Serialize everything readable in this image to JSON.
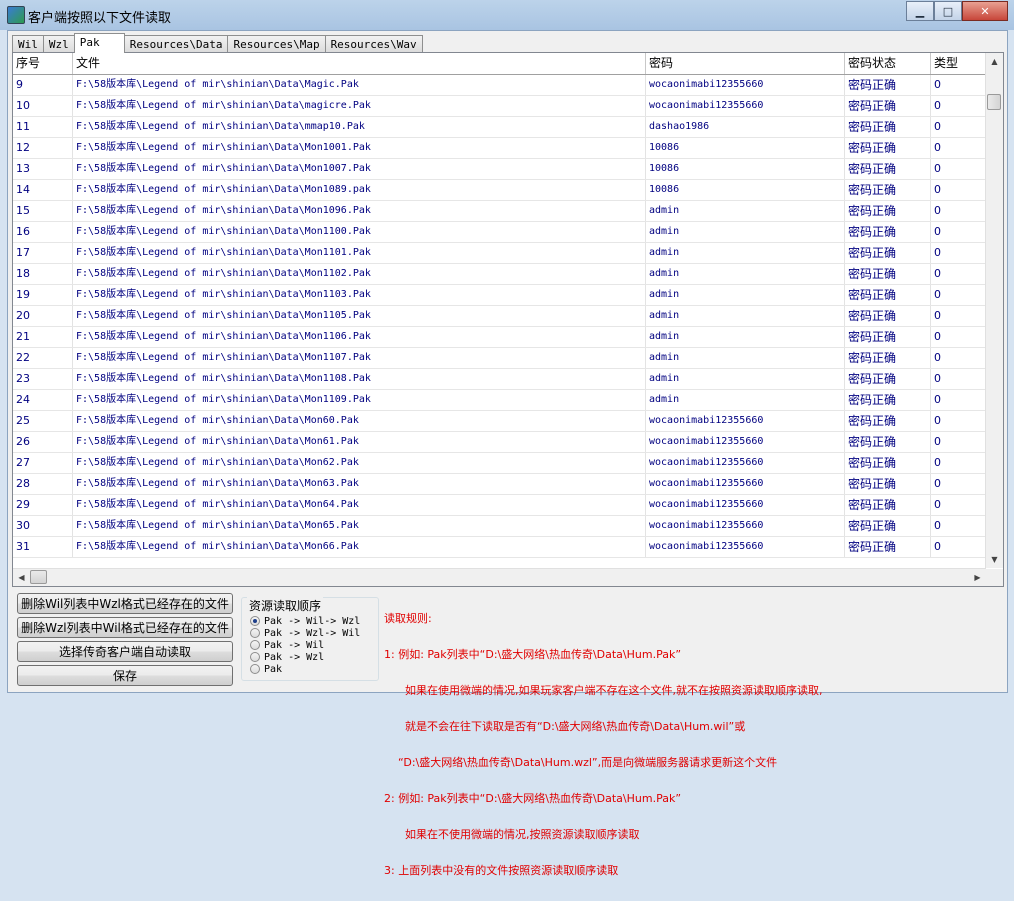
{
  "window": {
    "title": "客户端按照以下文件读取",
    "min_label": "▁",
    "max_label": "□",
    "close_label": "✕"
  },
  "tabs": [
    "Wil",
    "Wzl",
    "Pak",
    "Resources\\Data",
    "Resources\\Map",
    "Resources\\Wav"
  ],
  "active_tab": "Pak",
  "table": {
    "columns": [
      "序号",
      "文件",
      "密码",
      "密码状态",
      "类型"
    ],
    "rows": [
      [
        "9",
        "F:\\58版本库\\Legend of mir\\shinian\\Data\\Magic.Pak",
        "wocaonimabi12355660",
        "密码正确",
        "0"
      ],
      [
        "10",
        "F:\\58版本库\\Legend of mir\\shinian\\Data\\magicre.Pak",
        "wocaonimabi12355660",
        "密码正确",
        "0"
      ],
      [
        "11",
        "F:\\58版本库\\Legend of mir\\shinian\\Data\\mmap10.Pak",
        "dashao1986",
        "密码正确",
        "0"
      ],
      [
        "12",
        "F:\\58版本库\\Legend of mir\\shinian\\Data\\Mon1001.Pak",
        "10086",
        "密码正确",
        "0"
      ],
      [
        "13",
        "F:\\58版本库\\Legend of mir\\shinian\\Data\\Mon1007.Pak",
        "10086",
        "密码正确",
        "0"
      ],
      [
        "14",
        "F:\\58版本库\\Legend of mir\\shinian\\Data\\Mon1089.pak",
        "10086",
        "密码正确",
        "0"
      ],
      [
        "15",
        "F:\\58版本库\\Legend of mir\\shinian\\Data\\Mon1096.Pak",
        "admin",
        "密码正确",
        "0"
      ],
      [
        "16",
        "F:\\58版本库\\Legend of mir\\shinian\\Data\\Mon1100.Pak",
        "admin",
        "密码正确",
        "0"
      ],
      [
        "17",
        "F:\\58版本库\\Legend of mir\\shinian\\Data\\Mon1101.Pak",
        "admin",
        "密码正确",
        "0"
      ],
      [
        "18",
        "F:\\58版本库\\Legend of mir\\shinian\\Data\\Mon1102.Pak",
        "admin",
        "密码正确",
        "0"
      ],
      [
        "19",
        "F:\\58版本库\\Legend of mir\\shinian\\Data\\Mon1103.Pak",
        "admin",
        "密码正确",
        "0"
      ],
      [
        "20",
        "F:\\58版本库\\Legend of mir\\shinian\\Data\\Mon1105.Pak",
        "admin",
        "密码正确",
        "0"
      ],
      [
        "21",
        "F:\\58版本库\\Legend of mir\\shinian\\Data\\Mon1106.Pak",
        "admin",
        "密码正确",
        "0"
      ],
      [
        "22",
        "F:\\58版本库\\Legend of mir\\shinian\\Data\\Mon1107.Pak",
        "admin",
        "密码正确",
        "0"
      ],
      [
        "23",
        "F:\\58版本库\\Legend of mir\\shinian\\Data\\Mon1108.Pak",
        "admin",
        "密码正确",
        "0"
      ],
      [
        "24",
        "F:\\58版本库\\Legend of mir\\shinian\\Data\\Mon1109.Pak",
        "admin",
        "密码正确",
        "0"
      ],
      [
        "25",
        "F:\\58版本库\\Legend of mir\\shinian\\Data\\Mon60.Pak",
        "wocaonimabi12355660",
        "密码正确",
        "0"
      ],
      [
        "26",
        "F:\\58版本库\\Legend of mir\\shinian\\Data\\Mon61.Pak",
        "wocaonimabi12355660",
        "密码正确",
        "0"
      ],
      [
        "27",
        "F:\\58版本库\\Legend of mir\\shinian\\Data\\Mon62.Pak",
        "wocaonimabi12355660",
        "密码正确",
        "0"
      ],
      [
        "28",
        "F:\\58版本库\\Legend of mir\\shinian\\Data\\Mon63.Pak",
        "wocaonimabi12355660",
        "密码正确",
        "0"
      ],
      [
        "29",
        "F:\\58版本库\\Legend of mir\\shinian\\Data\\Mon64.Pak",
        "wocaonimabi12355660",
        "密码正确",
        "0"
      ],
      [
        "30",
        "F:\\58版本库\\Legend of mir\\shinian\\Data\\Mon65.Pak",
        "wocaonimabi12355660",
        "密码正确",
        "0"
      ],
      [
        "31",
        "F:\\58版本库\\Legend of mir\\shinian\\Data\\Mon66.Pak",
        "wocaonimabi12355660",
        "密码正确",
        "0"
      ]
    ]
  },
  "buttons": {
    "delete_wil": "删除Wil列表中Wzl格式已经存在的文件",
    "delete_wzl": "删除Wzl列表中Wil格式已经存在的文件",
    "auto_read": "选择传奇客户端自动读取",
    "save": "保存"
  },
  "read_order": {
    "title": "资源读取顺序",
    "options": [
      "Pak -> Wil-> Wzl",
      "Pak -> Wzl-> Wil",
      "Pak -> Wil",
      "Pak -> Wzl",
      "Pak"
    ],
    "selected_index": 0
  },
  "rules": {
    "lines": [
      "读取规则:",
      "1: 例如: Pak列表中“D:\\盛大网络\\热血传奇\\Data\\Hum.Pak”",
      "      如果在使用微端的情况,如果玩家客户端不存在这个文件,就不在按照资源读取顺序读取,",
      "      就是不会在往下读取是否有“D:\\盛大网络\\热血传奇\\Data\\Hum.wil”或",
      "    “D:\\盛大网络\\热血传奇\\Data\\Hum.wzl”,而是向微端服务器请求更新这个文件",
      "2: 例如: Pak列表中“D:\\盛大网络\\热血传奇\\Data\\Hum.Pak”",
      "      如果在不使用微端的情况,按照资源读取顺序读取",
      "3: 上面列表中没有的文件按照资源读取顺序读取"
    ]
  },
  "icons": {
    "app": "app-icon",
    "scroll_up": "chevron-up-icon",
    "scroll_down": "chevron-down-icon",
    "scroll_left": "chevron-left-icon",
    "scroll_right": "chevron-right-icon"
  },
  "colors": {
    "cell_text": "#000080",
    "rules_text": "#e00000"
  }
}
